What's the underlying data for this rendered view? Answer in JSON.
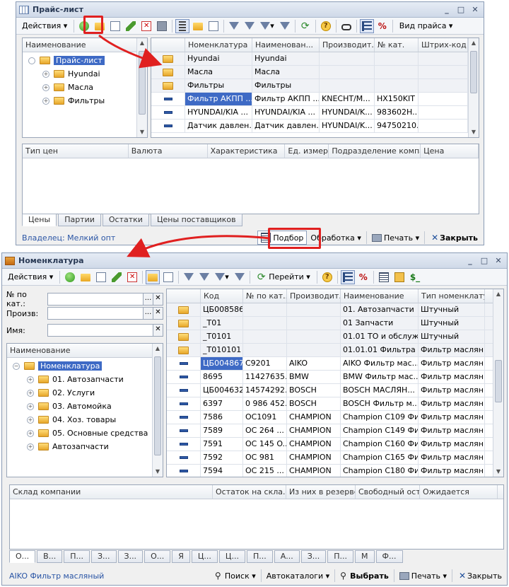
{
  "pricelist": {
    "title": "Прайс-лист",
    "actions_label": "Действия",
    "view_label": "Вид прайса",
    "tree": {
      "header": "Наименование",
      "items": [
        {
          "label": "Прайс-лист",
          "level": 0,
          "selected": true
        },
        {
          "label": "Hyundai",
          "level": 1
        },
        {
          "label": "Масла",
          "level": 1
        },
        {
          "label": "Фильтры",
          "level": 1
        }
      ]
    },
    "grid": {
      "columns": [
        "Номенклатура",
        "Наименован...",
        "Производит...",
        "№ кат.",
        "Штрих-код"
      ],
      "rows": [
        {
          "type": "folder",
          "cells": [
            "Hyundai",
            "Hyundai",
            "",
            "",
            ""
          ]
        },
        {
          "type": "folder",
          "cells": [
            "Масла",
            "Масла",
            "",
            "",
            ""
          ]
        },
        {
          "type": "folder",
          "cells": [
            "Фильтры",
            "Фильтры",
            "",
            "",
            ""
          ]
        },
        {
          "type": "item",
          "selected": true,
          "cells": [
            "Фильтр АКПП ...",
            "Фильтр АКПП ...",
            "KNECHT/M...",
            "HX150KIT",
            ""
          ]
        },
        {
          "type": "item",
          "cells": [
            "HYUNDAI/KIA ...",
            "HYUNDAI/KIA ...",
            "HYUNDAI/K...",
            "983602H...",
            ""
          ]
        },
        {
          "type": "item",
          "cells": [
            "Датчик давлен...",
            "Датчик давлен...",
            "HYUNDAI/K...",
            "94750210...",
            ""
          ]
        }
      ]
    },
    "prices": {
      "columns": [
        "Тип цен",
        "Валюта",
        "Характеристика",
        "Ед. измер...",
        "Подразделение компа...",
        "Цена"
      ]
    },
    "tabs": [
      "Цены",
      "Партии",
      "Остатки",
      "Цены поставщиков"
    ],
    "owner": "Владелец: Мелкий опт",
    "pick_label": "Подбор",
    "process_label": "Обработка",
    "print_label": "Печать",
    "close_label": "Закрыть"
  },
  "nomenclature": {
    "title": "Номенклатура",
    "actions_label": "Действия",
    "go_label": "Перейти",
    "filters": {
      "catalog_label": "№ по кат.:",
      "maker_label": "Произв:",
      "name_label": "Имя:"
    },
    "tree": {
      "header": "Наименование",
      "items": [
        {
          "label": "Номенклатура",
          "level": 0,
          "selected": true,
          "open": true
        },
        {
          "label": "01. Автозапчасти",
          "level": 1
        },
        {
          "label": "02. Услуги",
          "level": 1
        },
        {
          "label": "03. Автомойка",
          "level": 1
        },
        {
          "label": "04. Хоз. товары",
          "level": 1
        },
        {
          "label": "05. Основные средства",
          "level": 1
        },
        {
          "label": "Автозапчасти",
          "level": 1
        }
      ]
    },
    "grid": {
      "columns": [
        "Код",
        "№ по кат...",
        "Производит...",
        "Наименование",
        "Тип номенклату..."
      ],
      "rows": [
        {
          "type": "folder",
          "cells": [
            "ЦБ008586",
            "",
            "",
            "01. Автозапчасти",
            "Штучный"
          ]
        },
        {
          "type": "folder",
          "cells": [
            "_T01",
            "",
            "",
            "01 Запчасти",
            "Штучный"
          ]
        },
        {
          "type": "folder",
          "cells": [
            "_T0101",
            "",
            "",
            "01.01 ТО и обслуж...",
            "Штучный"
          ]
        },
        {
          "type": "folder",
          "cells": [
            "_T010101",
            "",
            "",
            "01.01.01 Фильтра ...",
            "Фильтр маслян..."
          ]
        },
        {
          "type": "item",
          "selected": true,
          "cells": [
            "ЦБ004867",
            "C9201",
            "AIKO",
            "AIKO Фильтр мас...",
            "Фильтр маслян..."
          ]
        },
        {
          "type": "item",
          "cells": [
            "8695",
            "11427635...",
            "BMW",
            "BMW Фильтр мас...",
            "Фильтр маслян..."
          ]
        },
        {
          "type": "item",
          "cells": [
            "ЦБ004632",
            "14574292...",
            "BOSCH",
            "BOSCH МАСЛЯН...",
            "Фильтр маслян..."
          ]
        },
        {
          "type": "item",
          "cells": [
            "6397",
            "0 986 452...",
            "BOSCH",
            "BOSCH Фильтр м...",
            "Фильтр маслян..."
          ]
        },
        {
          "type": "item",
          "cells": [
            "7586",
            "OC1091",
            "CHAMPION",
            "Champion C109 Фи...",
            "Фильтр маслян..."
          ]
        },
        {
          "type": "item",
          "cells": [
            "7589",
            "OC 264 ...",
            "CHAMPION",
            "Champion C149 Фи...",
            "Фильтр маслян..."
          ]
        },
        {
          "type": "item",
          "cells": [
            "7591",
            "OC 145 O...",
            "CHAMPION",
            "Champion C160 Фи...",
            "Фильтр маслян..."
          ]
        },
        {
          "type": "item",
          "cells": [
            "7592",
            "OC 981",
            "CHAMPION",
            "Champion C165 Фи...",
            "Фильтр маслян..."
          ]
        },
        {
          "type": "item",
          "cells": [
            "7594",
            "OC 215 ...",
            "CHAMPION",
            "Champion C180 Фи...",
            "Фильтр маслян..."
          ]
        }
      ]
    },
    "stock": {
      "columns": [
        "Склад компании",
        "Остаток на скла...",
        "Из них в резерве",
        "Свободный оста...",
        "Ожидается"
      ]
    },
    "tabs": [
      "О...",
      "В...",
      "П...",
      "З...",
      "З...",
      "О...",
      "Я",
      "Ц...",
      "Ц...",
      "П...",
      "А...",
      "З...",
      "П...",
      "М",
      "Ф..."
    ],
    "status_text": "AIKO Фильтр масляный",
    "search_label": "Поиск",
    "autocat_label": "Автокаталоги",
    "select_label": "Выбрать",
    "print_label": "Печать",
    "close_label": "Закрыть"
  },
  "icons": {
    "add": "add-icon",
    "new_folder": "new-folder-icon",
    "copy": "copy-icon",
    "edit": "edit-icon",
    "delete": "delete-icon",
    "refresh": "refresh-icon",
    "help": "help-icon"
  },
  "colors": {
    "highlight": "#e02020",
    "selection": "#3e6ac5"
  }
}
